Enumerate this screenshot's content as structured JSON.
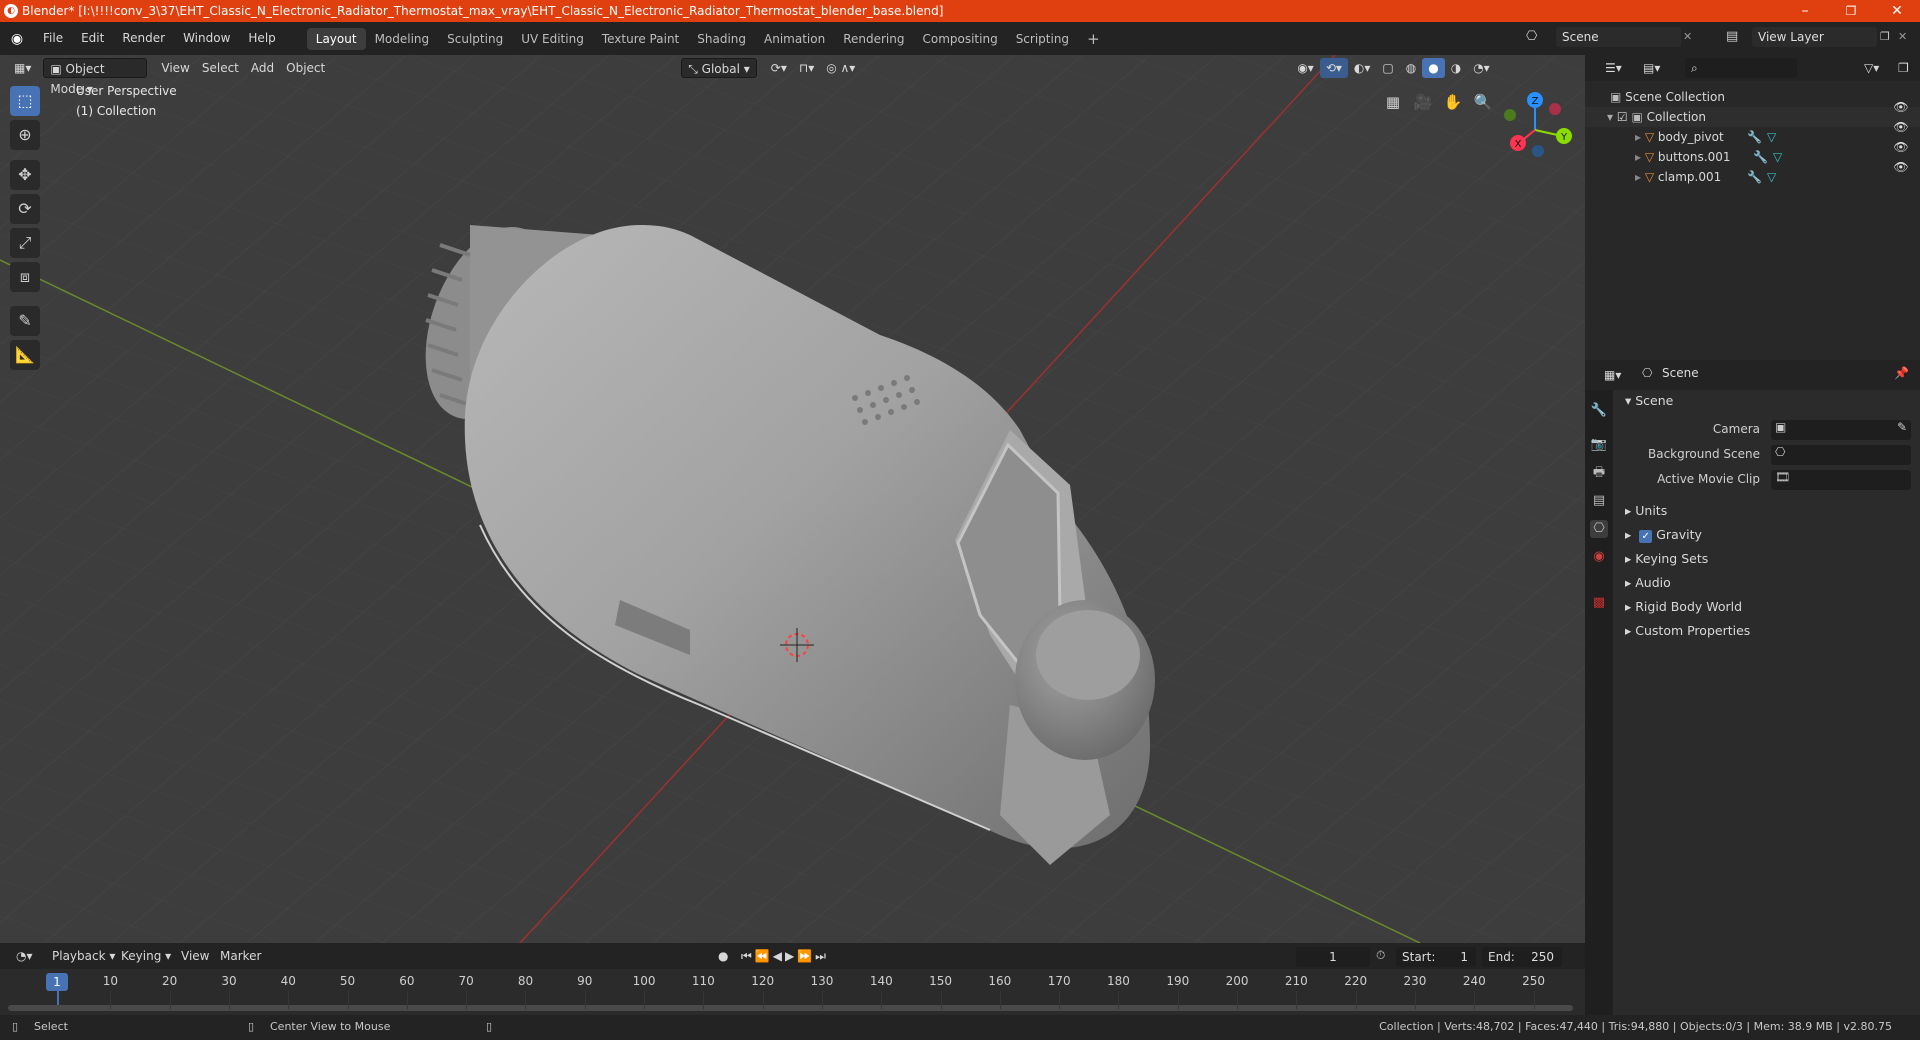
{
  "window": {
    "title": "Blender* [I:\\!!!!conv_3\\37\\EHT_Classic_N_Electronic_Radiator_Thermostat_max_vray\\EHT_Classic_N_Electronic_Radiator_Thermostat_blender_base.blend]",
    "controls": [
      "–",
      "❐",
      "✕"
    ]
  },
  "menus": [
    "File",
    "Edit",
    "Render",
    "Window",
    "Help"
  ],
  "workspaces": [
    "Layout",
    "Modeling",
    "Sculpting",
    "UV Editing",
    "Texture Paint",
    "Shading",
    "Animation",
    "Rendering",
    "Compositing",
    "Scripting"
  ],
  "active_workspace": "Layout",
  "top_right": {
    "scene": "Scene",
    "view_layer": "View Layer"
  },
  "viewport_header": {
    "mode": "Object Mode",
    "menus": [
      "View",
      "Select",
      "Add",
      "Object"
    ],
    "orientation": "Global"
  },
  "viewport": {
    "perspective_label": "User Perspective",
    "collection_label": "(1) Collection",
    "gizmo": {
      "x": "X",
      "y": "Y",
      "z": "Z"
    }
  },
  "timeline": {
    "menus": [
      "Playback",
      "Keying",
      "View",
      "Marker"
    ],
    "current_frame": "1",
    "start_label": "Start:",
    "start": "1",
    "end_label": "End:",
    "end": "250",
    "ticks": [
      "10",
      "20",
      "30",
      "40",
      "50",
      "60",
      "70",
      "80",
      "90",
      "100",
      "110",
      "120",
      "130",
      "140",
      "150",
      "160",
      "170",
      "180",
      "190",
      "200",
      "210",
      "220",
      "230",
      "240",
      "250"
    ]
  },
  "status": {
    "left_action": "Select",
    "middle_action": "Center View to Mouse",
    "stats": "Collection | Verts:48,702 | Faces:47,440 | Tris:94,880 | Objects:0/3 | Mem: 38.9 MB | v2.80.75"
  },
  "outliner": {
    "root": "Scene Collection",
    "collection": "Collection",
    "objects": [
      "body_pivot",
      "buttons.001",
      "clamp.001"
    ]
  },
  "properties": {
    "context": "Scene",
    "section": "Scene",
    "fields": [
      {
        "label": "Camera"
      },
      {
        "label": "Background Scene"
      },
      {
        "label": "Active Movie Clip"
      }
    ],
    "panels": [
      "Units",
      "Gravity",
      "Keying Sets",
      "Audio",
      "Rigid Body World",
      "Custom Properties"
    ]
  },
  "colors": {
    "titlebar": "#e0400f",
    "accent": "#4772b3",
    "x_axis": "#ff3352",
    "y_axis": "#8bdc00",
    "z_axis": "#2890ff"
  }
}
